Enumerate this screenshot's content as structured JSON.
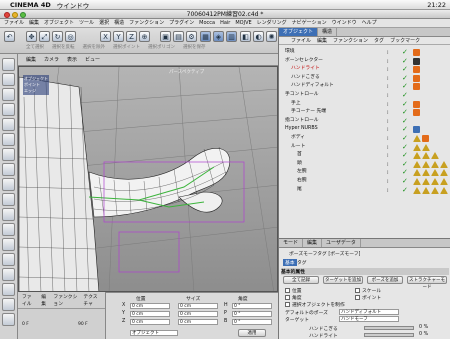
{
  "menubar": {
    "app_name": "CINEMA 4D",
    "items": [
      "ウインドウ"
    ],
    "clock": "21:22"
  },
  "window": {
    "title": "70060412PM練習02.c4d *"
  },
  "app_menu": [
    "ファイル",
    "編集",
    "オブジェクト",
    "ツール",
    "選択",
    "構造",
    "ファンクション",
    "プラグイン",
    "Mocca",
    "Hair",
    "MOJVE",
    "レンダリング",
    "ナビゲーション",
    "ウインドウ",
    "ヘルプ"
  ],
  "toolbar": {
    "row2_labels": [
      "全て選択",
      "選択を反転",
      "選択を除外",
      "選択ポイント",
      "選択ポリゴン",
      "選択を保存"
    ]
  },
  "viewport": {
    "menu": [
      "編集",
      "カメラ",
      "表示",
      "ビュー"
    ],
    "label": "パースペクティブ",
    "hud": [
      "オブジェクト",
      "ポイント",
      "エッジ"
    ]
  },
  "object_manager": {
    "tabs": [
      "オブジェクト",
      "構造"
    ],
    "menu": [
      "ファイル",
      "編集",
      "ファンクション",
      "タグ",
      "ブックマーク"
    ],
    "rows": [
      {
        "name": "環境",
        "red": false,
        "indent": 0,
        "tags": [
          "orange"
        ]
      },
      {
        "name": "ボーンセレクター",
        "red": false,
        "indent": 0,
        "tags": [
          "person"
        ]
      },
      {
        "name": "ハンドライト",
        "red": true,
        "indent": 1,
        "tags": [
          "orange"
        ]
      },
      {
        "name": "ハンドこぎる",
        "red": false,
        "indent": 1,
        "tags": [
          "orange"
        ]
      },
      {
        "name": "ハンドディフォルト",
        "red": false,
        "indent": 1,
        "tags": [
          "orange"
        ]
      },
      {
        "name": "手コントロール",
        "red": false,
        "indent": 0,
        "tags": []
      },
      {
        "name": "手上",
        "red": false,
        "indent": 1,
        "tags": [
          "orange"
        ]
      },
      {
        "name": "手コーナー 先端",
        "red": false,
        "indent": 1,
        "tags": [
          "orange"
        ]
      },
      {
        "name": "指コントロール",
        "red": false,
        "indent": 0,
        "tags": []
      },
      {
        "name": "Hyper NURBS",
        "red": false,
        "indent": 0,
        "tags": [
          "blue"
        ]
      },
      {
        "name": "ボディ",
        "red": false,
        "indent": 1,
        "tags": [
          "tri",
          "orange"
        ]
      },
      {
        "name": "ルート",
        "red": false,
        "indent": 1,
        "tags": [
          "tri",
          "tri"
        ]
      },
      {
        "name": "首",
        "red": false,
        "indent": 2,
        "tags": [
          "tri",
          "tri",
          "tri"
        ]
      },
      {
        "name": "頭",
        "red": false,
        "indent": 2,
        "tags": [
          "tri",
          "tri",
          "tri",
          "tri"
        ]
      },
      {
        "name": "左腕",
        "red": false,
        "indent": 2,
        "tags": [
          "tri",
          "tri",
          "tri",
          "tri"
        ]
      },
      {
        "name": "右腕",
        "red": false,
        "indent": 2,
        "tags": [
          "tri",
          "tri",
          "tri",
          "tri"
        ]
      },
      {
        "name": "尾",
        "red": false,
        "indent": 2,
        "tags": [
          "tri",
          "tri",
          "tri",
          "tri"
        ]
      }
    ]
  },
  "attributes": {
    "tabs": [
      "モード",
      "編集",
      "ユーザデータ"
    ],
    "object_label": "ポーズモーフタグ [ポーズモーフ]",
    "sub_tabs": [
      "基本",
      "タグ"
    ],
    "section_title": "基本的属性",
    "buttons": [
      "全て記録",
      "ターゲットを追加",
      "ポーズを追加",
      "ストラクチャーモード"
    ],
    "options": [
      "位置",
      "角度",
      "スケール",
      "ポイント",
      "選択オブジェクトを制作"
    ],
    "defaults_label": "デフォルトのポーズ",
    "defaults_value": "ハンドディフォルト",
    "target_label": "ターゲット",
    "target_value": "ハンドモーフ",
    "sliders": [
      {
        "label": "ハンドこぎる",
        "percent": "0 %",
        "value": 0.0
      },
      {
        "label": "ハンドライト",
        "percent": "0 %",
        "value": 0.0
      }
    ]
  },
  "materials": {
    "menu": [
      "ファイル",
      "編集",
      "ファンクション",
      "テクスチャ"
    ]
  },
  "coordinates": {
    "headers": [
      "位置",
      "サイズ",
      "角度"
    ],
    "rows": [
      {
        "axis": "X",
        "pos": "0 cm",
        "size": "0 cm",
        "angle": "H",
        "angle_val": "0 °"
      },
      {
        "axis": "Y",
        "pos": "0 cm",
        "size": "0 cm",
        "angle": "P",
        "angle_val": "0 °"
      },
      {
        "axis": "Z",
        "pos": "0 cm",
        "size": "0 cm",
        "angle": "B",
        "angle_val": "0 °"
      }
    ],
    "mode": "オブジェクト",
    "apply": "適用"
  },
  "timeline": {
    "frame": "0 F",
    "end": "90 F"
  }
}
